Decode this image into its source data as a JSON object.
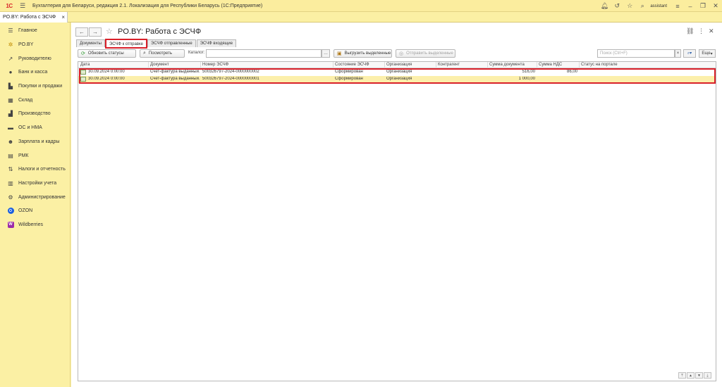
{
  "app": {
    "logo": "1С",
    "title": "Бухгалтерия для Беларуси, редакция 2.1. Локализация для Республики Беларусь  (1С:Предприятие)",
    "user": "assistant"
  },
  "open_tab": {
    "label": "PO.BY: Работа с ЭСЧФ"
  },
  "sidebar": {
    "items": [
      {
        "label": "Главное",
        "icon": "menu-icon"
      },
      {
        "label": "PO.BY",
        "icon": "sun-icon"
      },
      {
        "label": "Руководителю",
        "icon": "trend-icon"
      },
      {
        "label": "Банк и касса",
        "icon": "bank-icon"
      },
      {
        "label": "Покупки и продажи",
        "icon": "cart-icon"
      },
      {
        "label": "Склад",
        "icon": "warehouse-icon"
      },
      {
        "label": "Производство",
        "icon": "factory-icon"
      },
      {
        "label": "ОС и НМА",
        "icon": "truck-icon"
      },
      {
        "label": "Зарплата и кадры",
        "icon": "people-icon"
      },
      {
        "label": "РМК",
        "icon": "register-icon"
      },
      {
        "label": "Налоги и отчетность",
        "icon": "tax-icon"
      },
      {
        "label": "Настройки учета",
        "icon": "book-icon"
      },
      {
        "label": "Администрирование",
        "icon": "gear-icon"
      },
      {
        "label": "OZON",
        "icon": "ozon-icon"
      },
      {
        "label": "Wildberries",
        "icon": "wildberries-icon"
      }
    ]
  },
  "page": {
    "title": "PO.BY: Работа с ЭСЧФ"
  },
  "form_tabs": [
    {
      "label": "Документы"
    },
    {
      "label": "ЭСЧФ к отправке"
    },
    {
      "label": "ЭСЧФ отправленные"
    },
    {
      "label": "ЭСЧФ входящие"
    }
  ],
  "toolbar": {
    "refresh_label": "Обновить статусы",
    "view_label": "Посмотреть",
    "catalog_label": "Каталог:",
    "catalog_value": "",
    "export_label": "Выгрузить выделенные",
    "send_label": "Отправить выделенные",
    "search_placeholder": "Поиск (Ctrl+F)",
    "more_label": "Еще"
  },
  "table": {
    "columns": [
      "Дата",
      "Документ",
      "Номер ЭСЧФ",
      "Состояние ЭСЧФ",
      "Организация",
      "Контрагент",
      "Сумма документа",
      "Сумма НДС",
      "Статус на портале"
    ],
    "rows": [
      {
        "date": "30.09.2024 0:00:00",
        "document": "Счет-фактура выданный...",
        "number": "500326797-2024-0000000002",
        "state": "Сформирован",
        "org": "Организация",
        "contractor": "",
        "sum": "516,00",
        "vat": "86,00",
        "status": ""
      },
      {
        "date": "30.09.2024 0:00:00",
        "document": "Счет-фактура выданный...",
        "number": "500326797-2024-0000000001",
        "state": "Сформирован",
        "org": "Организация",
        "contractor": "",
        "sum": "1 000,00",
        "vat": "",
        "status": ""
      }
    ]
  }
}
